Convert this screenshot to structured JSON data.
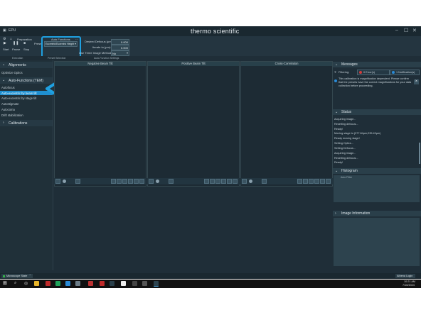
{
  "window": {
    "app": "EPU",
    "brand": "thermo scientific",
    "min": "–",
    "max": "☐",
    "close": "✕"
  },
  "toolbar": {
    "menu_home": "Preparation",
    "start": "Start",
    "pause": "Pause",
    "stop": "Stop",
    "preset_label": "Preset",
    "autofunctions_label": "Auto Functions",
    "autofunctions_value": "Eucentric/Eucentric Height",
    "desired_defocus_label": "Desired Defocus (µm):",
    "desired_defocus_value": "0.000",
    "iterate_label": "Iterate to (µm):",
    "iterate_value": "0.000",
    "three_image_label": "Use Three Image Method:",
    "three_image_value": "No"
  },
  "subbar": {
    "a": "Execution",
    "b": "Preset Selection",
    "c": "Auto-Function Settings"
  },
  "sidebar": {
    "alignments": "Alignments",
    "optimize_optics": "Optimize Optics",
    "autofunctions": "Auto-Functions (TEM)",
    "items": [
      "Autofocus",
      "Auto-eucentric by beam tilt",
      "Auto-eucentric by stage tilt",
      "Autostigmate",
      "Autocoma",
      "Drift stabilization"
    ],
    "calibrations": "Calibrations"
  },
  "panels": [
    "Negative Beam Tilt",
    "Positive Beam Tilt",
    "Cross-Correlation"
  ],
  "messages": {
    "title": "Messages",
    "filtering": "Filtering:",
    "errors": "0 Error(s)",
    "notifications": "1 Notification(s)",
    "note": "This calibration is magnification dependent. Please confirm that the presets have the correct magnifications for your data collection before proceeding."
  },
  "status": {
    "title": "Status",
    "lines": [
      "Acquiring image...",
      "Resetting defocus...",
      "Ready!",
      "Moving stage to (377.84µm;235.49µm)",
      "Ready moving stage!",
      "Setting Optics...",
      "Setting Defocus...",
      "Acquiring image...",
      "Resetting defocus...",
      "Ready!"
    ]
  },
  "histogram": {
    "title": "Histogram",
    "auto_filter": "Auto Filter"
  },
  "image_info": {
    "title": "Image Information"
  },
  "statusbar": {
    "microscope": "Microscope State",
    "athena": "Athena Login"
  },
  "taskbar": {
    "time": "10:21 AM",
    "date": "7/16/2024"
  }
}
